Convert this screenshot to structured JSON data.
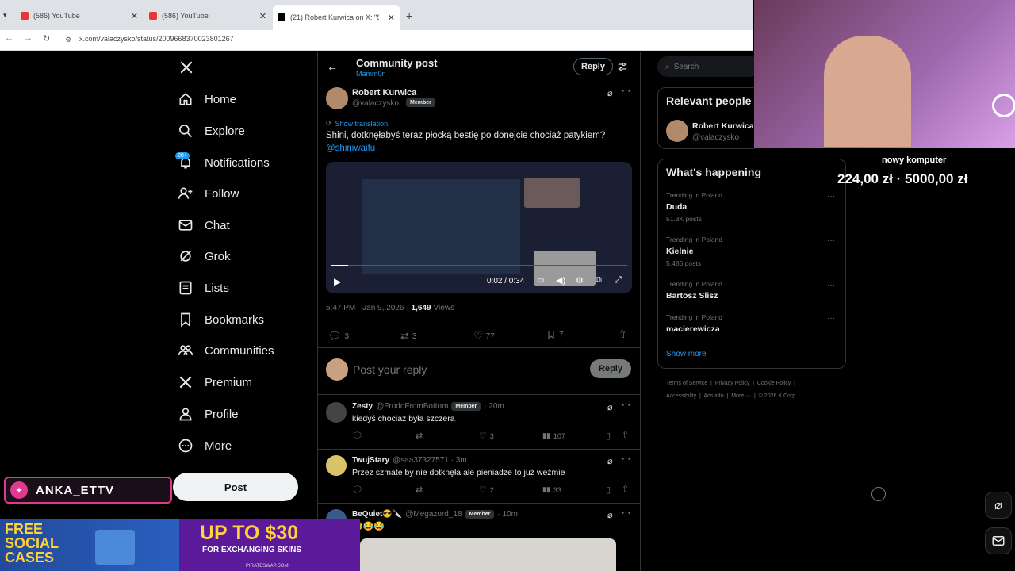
{
  "browser": {
    "tabs": [
      {
        "title": "(586) YouTube"
      },
      {
        "title": "(586) YouTube"
      },
      {
        "title": "(21) Robert Kurwica on X: \"Shin"
      }
    ],
    "url": "x.com/valaczysko/status/2009668370023801267"
  },
  "nav": {
    "items": [
      {
        "label": "Home"
      },
      {
        "label": "Explore"
      },
      {
        "label": "Notifications",
        "badge": "20+"
      },
      {
        "label": "Follow"
      },
      {
        "label": "Chat"
      },
      {
        "label": "Grok"
      },
      {
        "label": "Lists"
      },
      {
        "label": "Bookmarks"
      },
      {
        "label": "Communities"
      },
      {
        "label": "Premium"
      },
      {
        "label": "Profile"
      },
      {
        "label": "More"
      }
    ],
    "post_button": "Post"
  },
  "header": {
    "title": "Community post",
    "subtitle": "Mamm0n",
    "reply_button": "Reply"
  },
  "post": {
    "author_name": "Robert Kurwica",
    "author_handle": "@valaczysko",
    "member_badge": "Member",
    "show_translation": "Show translation",
    "text": "Shini, dotknęłabyś teraz płocką bestię po donejcie chociaż patykiem?",
    "mention": "@shiniwaifu",
    "video_time": "0:02 / 0:34",
    "video_progress": 0.06,
    "timestamp": "5:47 PM · Jan 9, 2026 ·",
    "views_count": "1,649",
    "views_label": "Views",
    "replies": "3",
    "reposts": "3",
    "likes": "77",
    "bookmarks": "7"
  },
  "composer": {
    "placeholder": "Post your reply",
    "reply_button": "Reply"
  },
  "replies": [
    {
      "name": "Zesty",
      "handle": "@FrodoFromBottom",
      "badge": "Member",
      "time": "· 20m",
      "text": "kiedyś chociaż była szczera",
      "replies": "",
      "reposts": "",
      "likes": "3",
      "views": "107"
    },
    {
      "name": "TwujStary",
      "handle": "@saa37327571 · 3m",
      "badge": "",
      "time": "",
      "text": "Przez szmate by nie dotknęła ale pieniadze to już weźmie",
      "replies": "",
      "reposts": "",
      "likes": "2",
      "views": "33"
    },
    {
      "name": "BeQuiet😎🔪",
      "handle": "@Megazord_18",
      "badge": "Member",
      "time": "· 10m",
      "text": "😂😂😂",
      "replies": "",
      "reposts": "",
      "likes": "",
      "views": ""
    }
  ],
  "sidebar": {
    "search_placeholder": "Search",
    "relevant_title": "Relevant people",
    "relevant_name": "Robert Kurwica",
    "relevant_handle": "@valaczysko",
    "happening_title": "What's happening",
    "trends": [
      {
        "context": "Trending in Poland",
        "name": "Duda",
        "posts": "51.3K posts"
      },
      {
        "context": "Trending in Poland",
        "name": "Kielnie",
        "posts": "5,485 posts"
      },
      {
        "context": "Trending in Poland",
        "name": "Bartosz Slisz",
        "posts": ""
      },
      {
        "context": "Trending in Poland",
        "name": "macierewicza",
        "posts": ""
      }
    ],
    "show_more": "Show more",
    "footer_line1": "Terms of Service  |  Privacy Policy  |  Cookie Policy  |",
    "footer_line2": "Accessibility  |  Ads info  |  More ···  |  © 2026 X Corp."
  },
  "stream": {
    "goal_label": "nowy komputer",
    "goal_values": "224,00 zł · 5000,00 zł",
    "streamer_name": "ANKA_ETTV",
    "ad_left": "FREE SOCIAL CASES",
    "ad_right_line1": "UP TO $30",
    "ad_right_line2": "FOR EXCHANGING SKINS",
    "ad_right_site": "PIRATESWAP.COM"
  }
}
